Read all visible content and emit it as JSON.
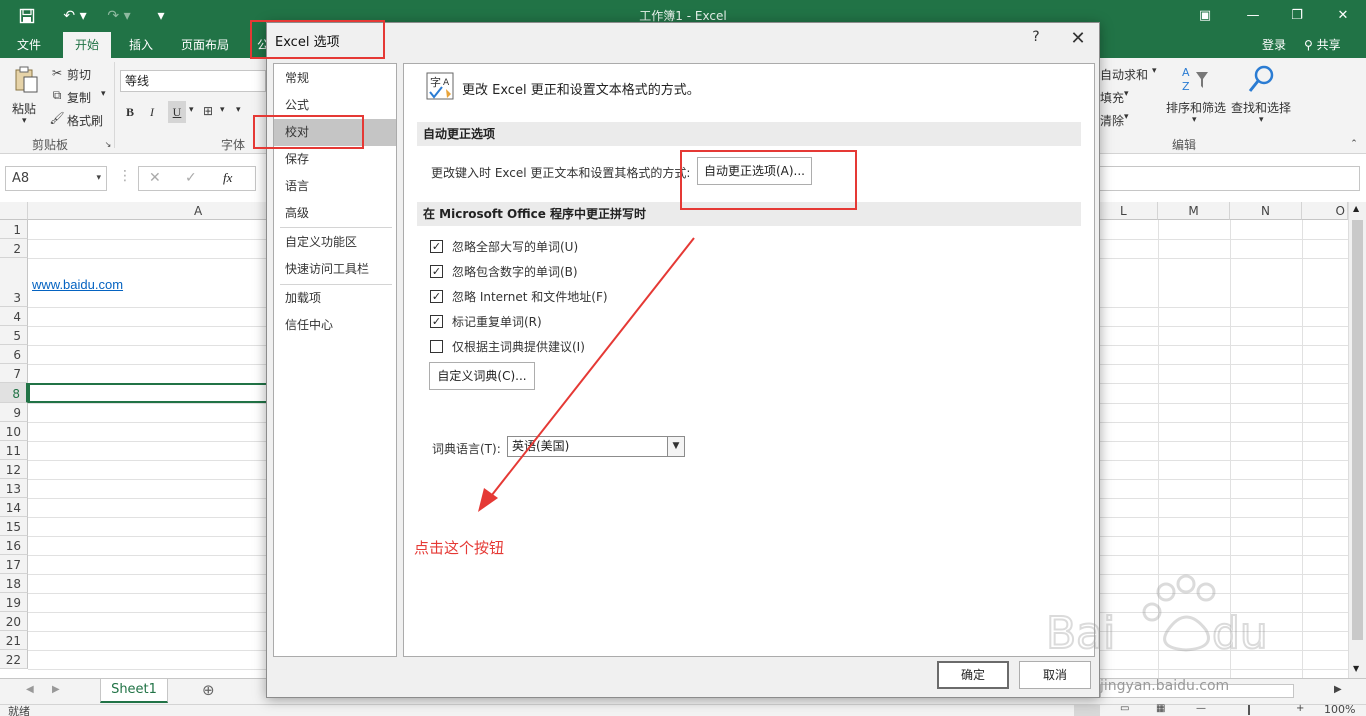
{
  "window": {
    "title": "工作簿1 - Excel"
  },
  "ribbon_tabs": [
    {
      "label": "文件"
    },
    {
      "label": "开始"
    },
    {
      "label": "插入"
    },
    {
      "label": "页面布局"
    },
    {
      "label": "公"
    }
  ],
  "account": {
    "login": "登录",
    "share": "共享"
  },
  "ribbon": {
    "paste": "粘贴",
    "cut": "剪切",
    "copy": "复制",
    "format_painter": "格式刷",
    "clipboard_group": "剪贴板",
    "font_name": "等线",
    "bold": "B",
    "italic": "I",
    "underline": "U",
    "font_group": "字体",
    "autosum": "自动求和",
    "fill": "填充",
    "clear": "清除",
    "sort_filter": "排序和筛选",
    "find_select": "查找和选择",
    "edit_group": "编辑"
  },
  "formula_bar": {
    "name_box": "A8",
    "fx": "fx"
  },
  "grid": {
    "columns_left": [
      "A"
    ],
    "columns_right": [
      "L",
      "M",
      "N",
      "O"
    ],
    "rows": [
      "1",
      "2",
      "3",
      "4",
      "5",
      "6",
      "7",
      "8",
      "9",
      "10",
      "11",
      "12",
      "13",
      "14",
      "15",
      "16",
      "17",
      "18",
      "19",
      "20",
      "21",
      "22"
    ],
    "cell_a3": "www.baidu.com",
    "selected_row": "8"
  },
  "sheets": {
    "tab": "Sheet1",
    "add": "⊕"
  },
  "status": {
    "ready": "就绪",
    "zoom": "100%"
  },
  "dialog": {
    "title": "Excel 选项",
    "help": "?",
    "close": "✕",
    "nav": [
      {
        "label": "常规"
      },
      {
        "label": "公式"
      },
      {
        "label": "校对"
      },
      {
        "label": "保存"
      },
      {
        "label": "语言"
      },
      {
        "label": "高级"
      },
      {
        "label": "自定义功能区"
      },
      {
        "label": "快速访问工具栏"
      },
      {
        "label": "加载项"
      },
      {
        "label": "信任中心"
      }
    ],
    "selected_nav": "校对",
    "header_text": "更改 Excel 更正和设置文本格式的方式。",
    "section_autocorrect": "自动更正选项",
    "autocorrect_desc": "更改键入时 Excel 更正文本和设置其格式的方式:",
    "autocorrect_button": "自动更正选项(A)...",
    "section_spelling": "在 Microsoft Office 程序中更正拼写时",
    "checkboxes": [
      {
        "label": "忽略全部大写的单词(U)",
        "checked": true
      },
      {
        "label": "忽略包含数字的单词(B)",
        "checked": true
      },
      {
        "label": "忽略 Internet 和文件地址(F)",
        "checked": true
      },
      {
        "label": "标记重复单词(R)",
        "checked": true
      },
      {
        "label": "仅根据主词典提供建议(I)",
        "checked": false
      }
    ],
    "custom_dict_button": "自定义词典(C)...",
    "dict_lang_label": "词典语言(T):",
    "dict_lang_value": "英语(美国)",
    "ok": "确定",
    "cancel": "取消"
  },
  "annotation": {
    "text": "点击这个按钮",
    "color": "#e53935"
  },
  "watermark": {
    "text": "jingyan.baidu.com"
  },
  "colors": {
    "excel_green": "#217346",
    "link_blue": "#0563c1"
  }
}
